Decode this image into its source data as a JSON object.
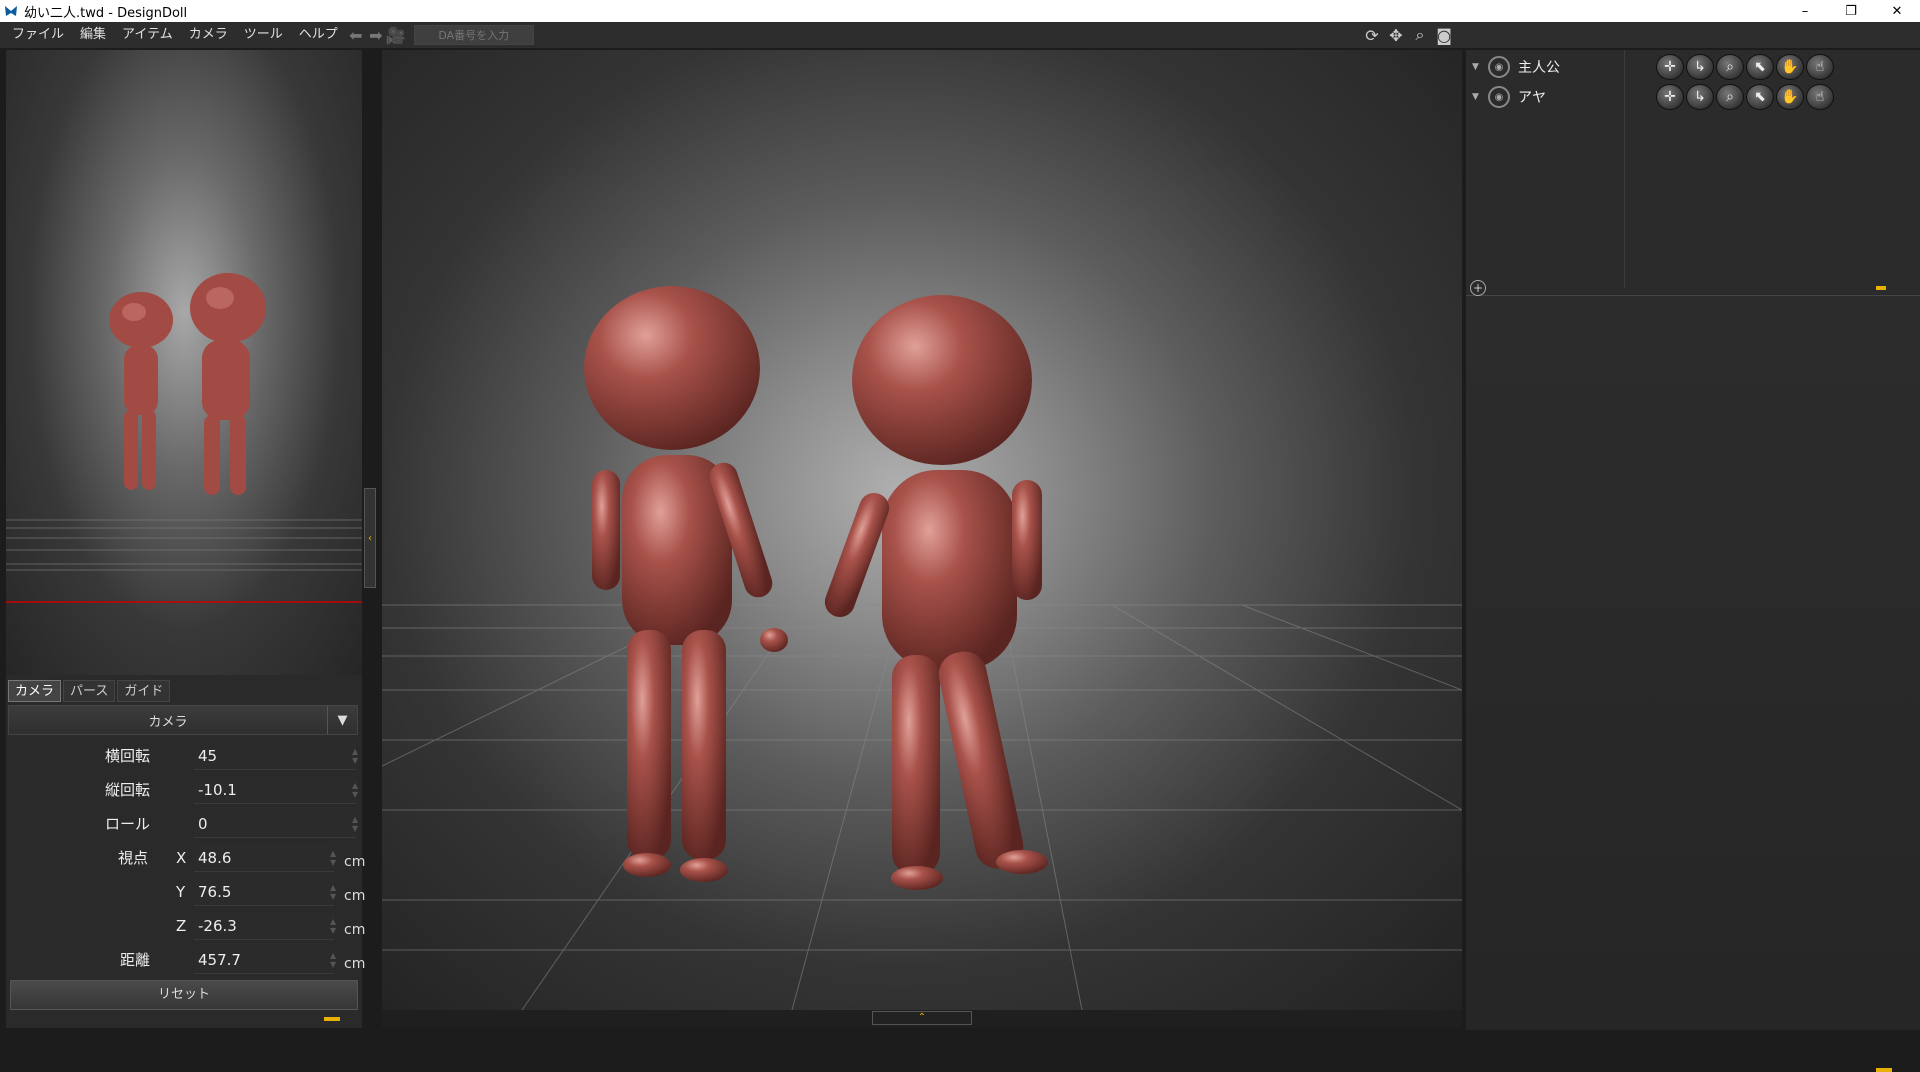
{
  "window": {
    "title": "幼い二人.twd - DesignDoll",
    "minimize": "–",
    "maximize": "❐",
    "close": "✕"
  },
  "menu": {
    "items": [
      "ファイル",
      "編集",
      "アイテム",
      "カメラ",
      "ツール",
      "ヘルプ"
    ],
    "da_placeholder": "DA番号を入力"
  },
  "toolbar_right_icons": [
    "rotate-icon",
    "move-icon",
    "zoom-icon",
    "camera-icon"
  ],
  "left_panel": {
    "tabs": [
      "カメラ",
      "パース",
      "ガイド"
    ],
    "active_tab": "カメラ",
    "dropdown_value": "カメラ",
    "props": {
      "h_rot": {
        "label": "横回転",
        "value": "45"
      },
      "v_rot": {
        "label": "縦回転",
        "value": "-10.1"
      },
      "roll": {
        "label": "ロール",
        "value": "0"
      },
      "vx": {
        "label": "視点",
        "axis": "X",
        "value": "48.6",
        "unit": "cm"
      },
      "vy": {
        "axis": "Y",
        "value": "76.5",
        "unit": "cm"
      },
      "vz": {
        "axis": "Z",
        "value": "-26.3",
        "unit": "cm"
      },
      "dist": {
        "label": "距離",
        "value": "457.7",
        "unit": "cm"
      }
    },
    "reset_label": "リセット"
  },
  "characters": [
    {
      "name": "主人公"
    },
    {
      "name": "アヤ"
    }
  ],
  "character_tools": [
    "posture-icon",
    "rotate-arrow-icon",
    "zoom-icon",
    "select-icon",
    "hand-open-icon",
    "hand-point-icon"
  ],
  "colors": {
    "accent": "#e8b000",
    "skin": "#a84a44"
  }
}
